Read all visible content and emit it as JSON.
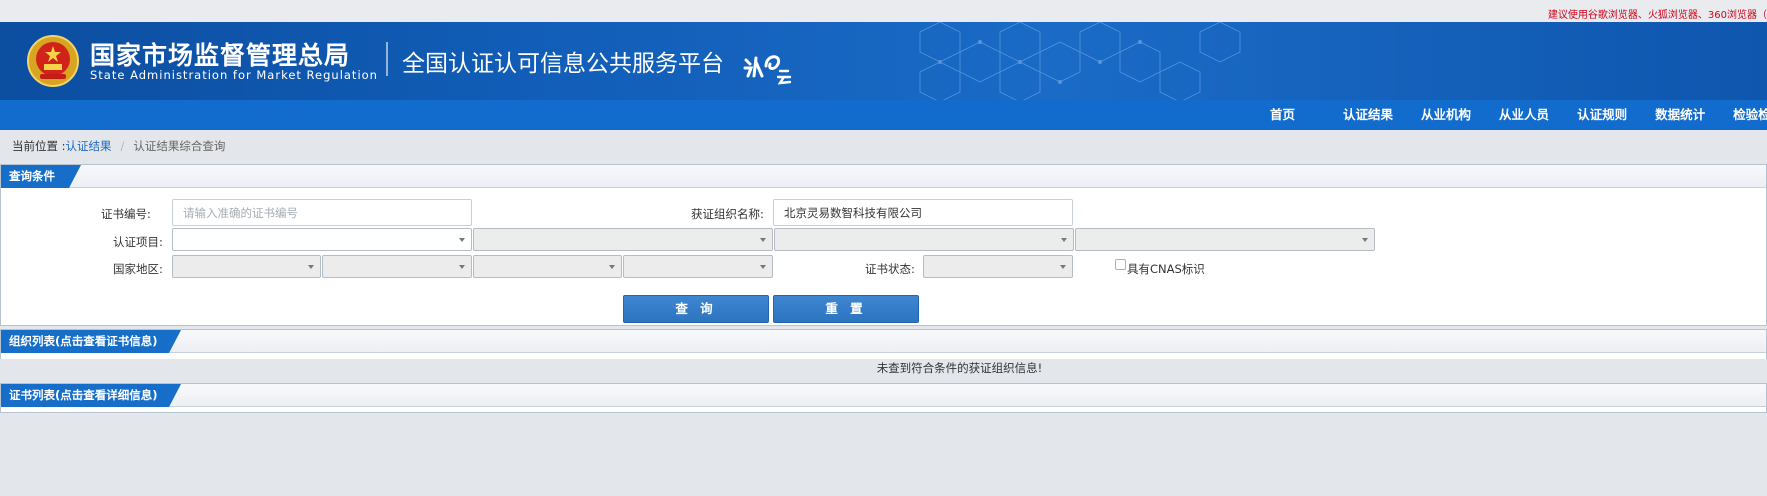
{
  "notice": "建议使用谷歌浏览器、火狐浏览器、360浏览器（",
  "header": {
    "org_cn": "国家市场监督管理总局",
    "org_en": "State Administration  for  Market Regulation",
    "platform_title": "全国认证认可信息公共服务平台",
    "logo_icon": "ren-cloud-logo",
    "emblem_icon": "national-emblem-icon",
    "bg_color": "#115db7"
  },
  "nav": {
    "items": [
      "首页",
      "认证结果",
      "从业机构",
      "从业人员",
      "认证规则",
      "数据统计",
      "检验检测"
    ],
    "bg_color": "#126ccd"
  },
  "breadcrumb": {
    "label": "当前位置 : ",
    "link": "认证结果",
    "separator": "/",
    "current": "认证结果综合查询"
  },
  "query_panel": {
    "title": "查询条件",
    "cert_no_label": "证书编号:",
    "cert_no_placeholder": "请输入准确的证书编号",
    "cert_no_value": "",
    "org_name_label": "获证组织名称:",
    "org_name_value": "北京灵易数智科技有限公司",
    "cert_item_label": "认证项目:",
    "region_label": "国家地区:",
    "status_label": "证书状态:",
    "cnas_label": "具有CNAS标识",
    "cnas_checked": false,
    "search_button": "查 询",
    "reset_button": "重 置",
    "accent_color": "#176ec9"
  },
  "org_panel": {
    "title": "组织列表(点击查看证书信息)",
    "empty_message": "未查到符合条件的获证组织信息!"
  },
  "cert_panel": {
    "title": "证书列表(点击查看详细信息)"
  }
}
